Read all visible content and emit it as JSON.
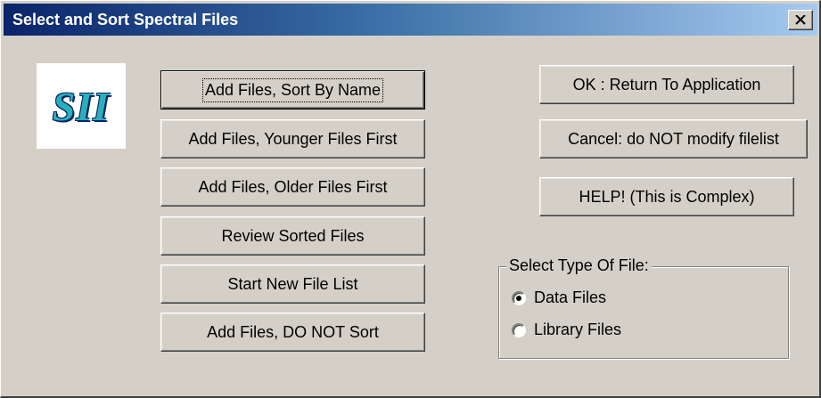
{
  "window": {
    "title": "Select and Sort Spectral Files",
    "close_glyph": "✕",
    "close_icon": "close-icon"
  },
  "logo": {
    "text": "SII"
  },
  "left_buttons": [
    {
      "label": "Add Files, Sort By Name",
      "default": true
    },
    {
      "label": "Add Files, Younger Files First"
    },
    {
      "label": "Add Files, Older Files First"
    },
    {
      "label": "Review Sorted Files"
    },
    {
      "label": "Start New File List"
    },
    {
      "label": "Add Files, DO NOT Sort"
    }
  ],
  "right_buttons": [
    {
      "label": "OK : Return To Application"
    },
    {
      "label": "Cancel:  do NOT modify filelist"
    },
    {
      "label": "HELP! (This is Complex)"
    }
  ],
  "file_type": {
    "label": "Select Type Of File:",
    "options": [
      {
        "label": "Data Files",
        "selected": true
      },
      {
        "label": "Library Files",
        "selected": false
      }
    ]
  }
}
